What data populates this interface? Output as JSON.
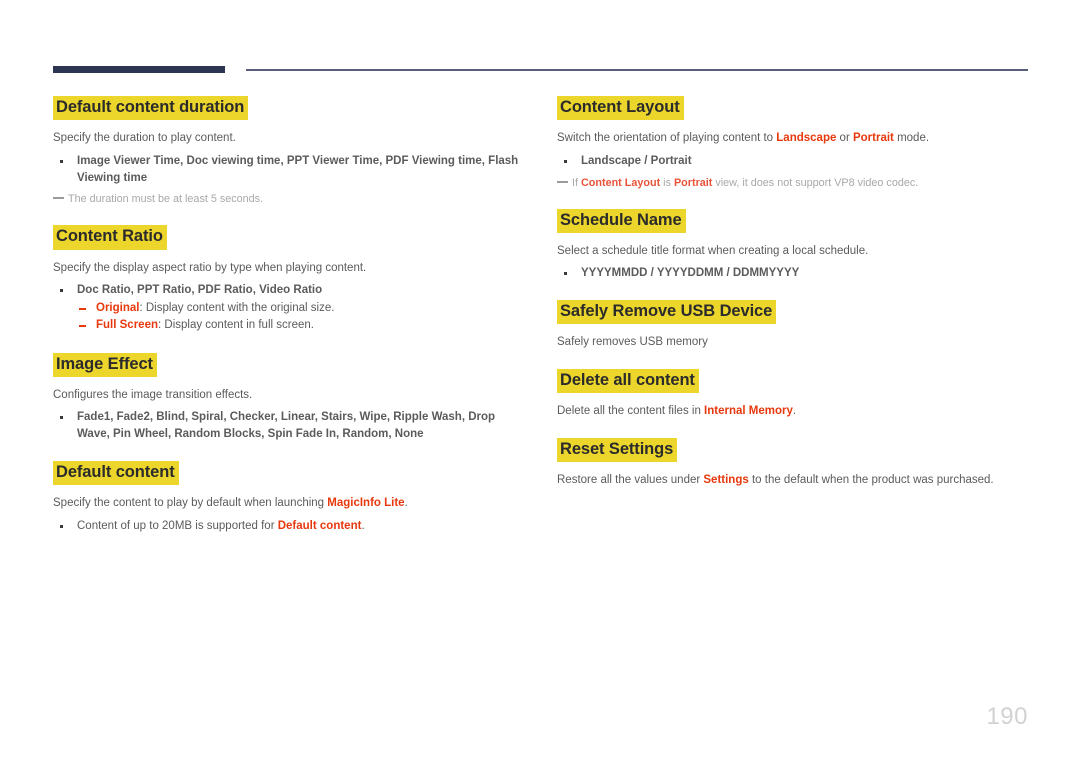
{
  "page": {
    "number": "190",
    "colors": {
      "heading_highlight": "#ecd62b",
      "accent_red": "#e8380d",
      "rule_navy": "#2e3553",
      "rule_thin": "#595f78",
      "body_gray": "#5b5b5b",
      "note_gray": "#a8a8a8",
      "page_number_gray": "#d2d2d2"
    }
  },
  "left_column": {
    "sections": [
      {
        "heading": "Default content duration",
        "intro": "Specify the duration to play content.",
        "bullets": [
          "Image Viewer Time, Doc viewing time, PPT Viewer Time, PDF Viewing time, Flash Viewing time"
        ],
        "note": "The duration must be at least 5 seconds."
      },
      {
        "heading": "Content Ratio",
        "intro": "Specify the display aspect ratio by type when playing content.",
        "bullets": [
          "Doc Ratio, PPT Ratio, PDF Ratio, Video Ratio"
        ],
        "sub_bullets": [
          {
            "term": "Original",
            "desc": ": Display content with the original size."
          },
          {
            "term": "Full Screen",
            "desc": ": Display content in full screen."
          }
        ]
      },
      {
        "heading": "Image Effect",
        "intro": "Configures the image transition effects.",
        "bullets": [
          "Fade1, Fade2, Blind, Spiral, Checker, Linear, Stairs, Wipe, Ripple Wash, Drop Wave, Pin Wheel, Random Blocks, Spin Fade In, Random, None"
        ]
      },
      {
        "heading": "Default content",
        "intro_parts": [
          {
            "text": "Specify the content to play by default when launching ",
            "em": false
          },
          {
            "text": "MagicInfo Lite",
            "em": true
          },
          {
            "text": ".",
            "em": false
          }
        ],
        "bullet_parts": [
          {
            "text": "Content of up to 20MB is supported for ",
            "em": false
          },
          {
            "text": "Default content",
            "em": true
          },
          {
            "text": ".",
            "em": false
          }
        ]
      }
    ]
  },
  "right_column": {
    "sections": [
      {
        "heading": "Content Layout",
        "intro_parts": [
          {
            "text": "Switch the orientation of playing content to ",
            "em": false
          },
          {
            "text": "Landscape",
            "em": true
          },
          {
            "text": " or ",
            "em": false
          },
          {
            "text": "Portrait",
            "em": true
          },
          {
            "text": " mode.",
            "em": false
          }
        ],
        "bullets": [
          "Landscape / Portrait"
        ],
        "note_parts": [
          {
            "text": "If ",
            "em": false
          },
          {
            "text": "Content Layout",
            "em": true
          },
          {
            "text": " is ",
            "em": false
          },
          {
            "text": "Portrait",
            "em": true
          },
          {
            "text": " view, it does not support VP8 video codec.",
            "em": false
          }
        ]
      },
      {
        "heading": "Schedule Name",
        "intro": "Select a schedule title format when creating a local schedule.",
        "bullets": [
          "YYYYMMDD / YYYYDDMM / DDMMYYYY"
        ]
      },
      {
        "heading": "Safely Remove USB Device",
        "intro": "Safely removes USB memory"
      },
      {
        "heading": "Delete all content",
        "intro_parts": [
          {
            "text": "Delete all the content files in ",
            "em": false
          },
          {
            "text": "Internal Memory",
            "em": true
          },
          {
            "text": ".",
            "em": false
          }
        ]
      },
      {
        "heading": "Reset Settings",
        "intro_parts": [
          {
            "text": "Restore all the values under ",
            "em": false
          },
          {
            "text": "Settings",
            "em": true
          },
          {
            "text": " to the default when the product was purchased.",
            "em": false
          }
        ]
      }
    ]
  }
}
